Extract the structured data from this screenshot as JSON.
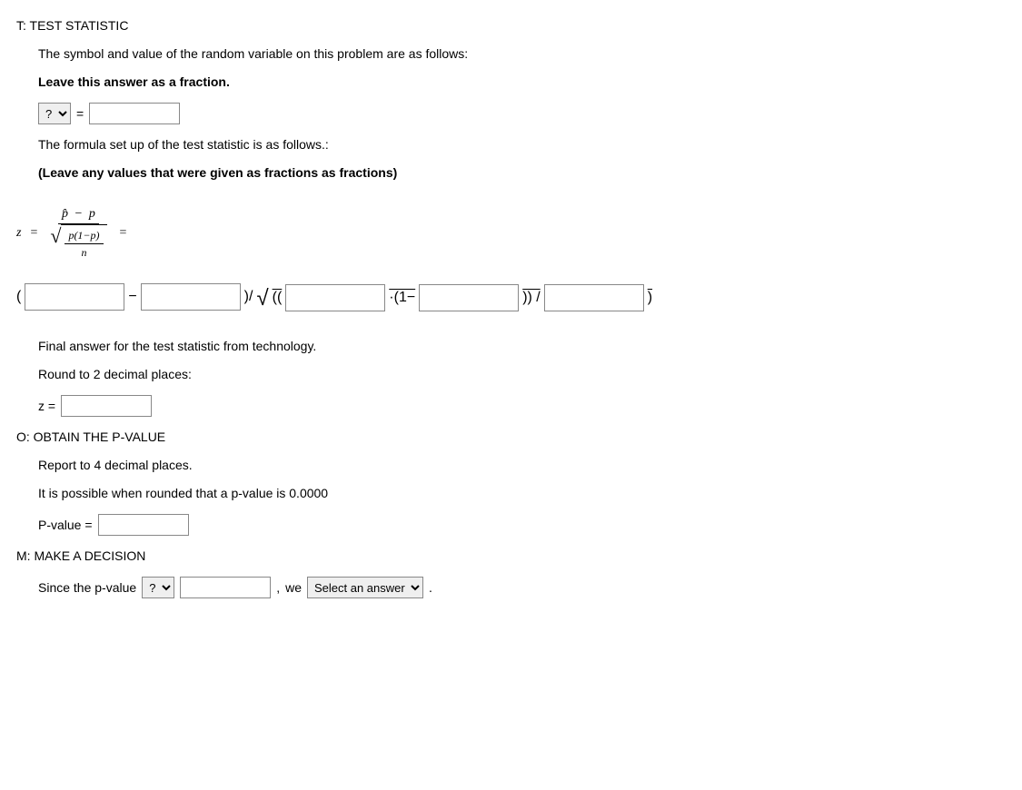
{
  "sectionT": {
    "heading": "T: TEST STATISTIC",
    "line1": "The symbol and value of the random variable on this problem are as follows:",
    "line2": "Leave this answer as a fraction.",
    "symbolSelect": "?",
    "eqSign": "=",
    "line3": "The formula set up of the test statistic is as follows.:",
    "line4": "(Leave any values that were given as fractions as fractions)",
    "formula": {
      "z": "z",
      "eq1": "=",
      "numLeft": "p̂",
      "minus": "−",
      "numRight": "p",
      "denInner": "p(1−p)",
      "denN": "n",
      "eq2": "="
    },
    "formulaLine": {
      "open1": "(",
      "dash": "−",
      "close1mid": ")/",
      "sqrtOpen": "((",
      "dot1minus": "·(1−",
      "close2": ")) /",
      "close3": ")"
    },
    "line5": "Final answer for the test statistic from technology.",
    "line6": "Round to 2 decimal places:",
    "zLabel": "z ="
  },
  "sectionO": {
    "heading": "O: OBTAIN THE P-VALUE",
    "line1": "Report to 4 decimal places.",
    "line2": "It is possible when rounded that a p-value is 0.0000",
    "pvalueLabel": "P-value ="
  },
  "sectionM": {
    "heading": "M: MAKE A DECISION",
    "line1a": "Since the p-value",
    "select1": "?",
    "comma": ",",
    "we": "we",
    "select2": "Select an answer",
    "period": "."
  }
}
